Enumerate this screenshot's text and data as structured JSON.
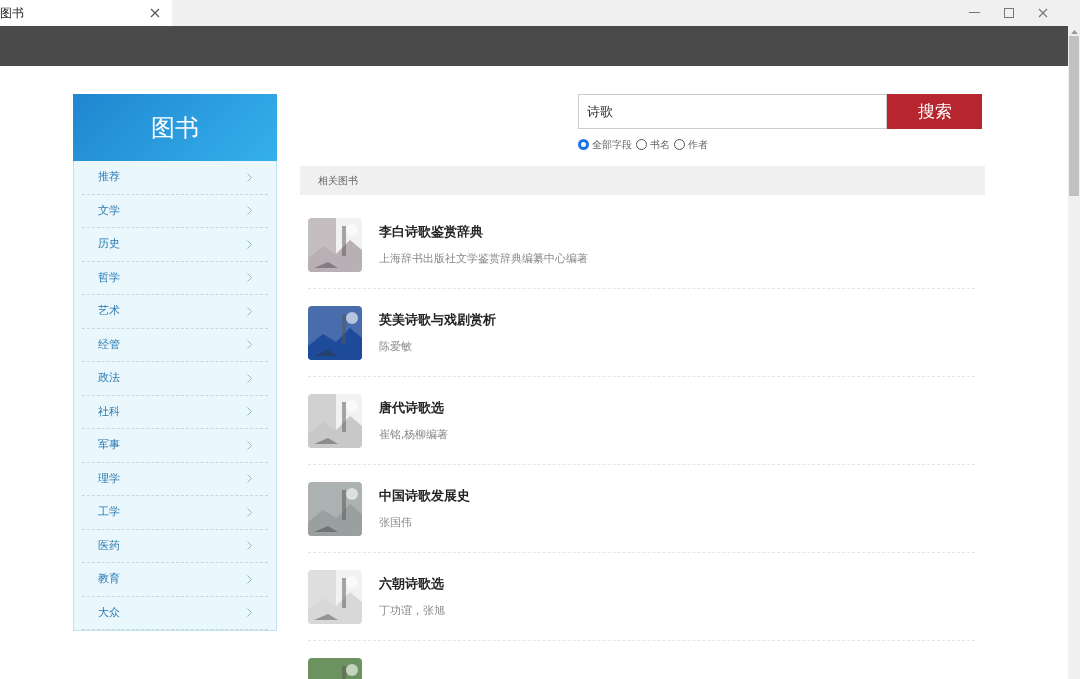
{
  "window": {
    "tab_title": "图书"
  },
  "sidebar": {
    "title": "图书",
    "items": [
      {
        "label": "推荐"
      },
      {
        "label": "文学"
      },
      {
        "label": "历史"
      },
      {
        "label": "哲学"
      },
      {
        "label": "艺术"
      },
      {
        "label": "经管"
      },
      {
        "label": "政法"
      },
      {
        "label": "社科"
      },
      {
        "label": "军事"
      },
      {
        "label": "理学"
      },
      {
        "label": "工学"
      },
      {
        "label": "医药"
      },
      {
        "label": "教育"
      },
      {
        "label": "大众"
      }
    ]
  },
  "search": {
    "value": "诗歌",
    "button": "搜索",
    "options": [
      {
        "label": "全部字段",
        "selected": true
      },
      {
        "label": "书名",
        "selected": false
      },
      {
        "label": "作者",
        "selected": false
      }
    ]
  },
  "results": {
    "heading": "相关图书",
    "books": [
      {
        "title": "李白诗歌鉴赏辞典",
        "author": "上海辞书出版社文学鉴赏辞典编纂中心编著",
        "cover": {
          "kind": "picture"
        }
      },
      {
        "title": "英美诗歌与戏剧赏析",
        "author": "陈爱敏",
        "cover": {
          "kind": "picture"
        }
      },
      {
        "title": "唐代诗歌选",
        "author": "崔铭,杨柳编著",
        "cover": {
          "kind": "picture"
        }
      },
      {
        "title": "中国诗歌发展史",
        "author": "张国伟",
        "cover": {
          "kind": "picture"
        }
      },
      {
        "title": "六朝诗歌选",
        "author": "丁功谊，张旭",
        "cover": {
          "kind": "picture"
        }
      },
      {
        "cover": {
          "kind": "picture"
        }
      }
    ]
  }
}
